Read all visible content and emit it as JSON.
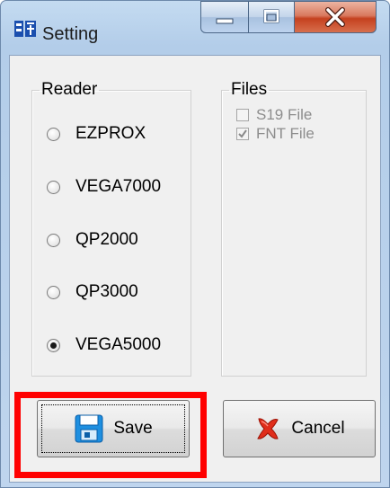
{
  "window": {
    "title": "Setting",
    "app_icon": "app-logo-icon",
    "controls": {
      "minimize": "minimize-icon",
      "maximize": "maximize-icon",
      "close": "close-icon"
    }
  },
  "reader_group": {
    "legend": "Reader",
    "options": [
      {
        "label": "EZPROX",
        "selected": false
      },
      {
        "label": "VEGA7000",
        "selected": false
      },
      {
        "label": "QP2000",
        "selected": false
      },
      {
        "label": "QP3000",
        "selected": false
      },
      {
        "label": "VEGA5000",
        "selected": true
      }
    ]
  },
  "files_group": {
    "legend": "Files",
    "items": [
      {
        "label": "S19 File",
        "checked": false,
        "enabled": false
      },
      {
        "label": "FNT File",
        "checked": true,
        "enabled": false
      }
    ]
  },
  "buttons": {
    "save_label": "Save",
    "save_icon": "floppy-disk-icon",
    "cancel_label": "Cancel",
    "cancel_icon": "red-x-icon"
  },
  "highlight_color": "#ff0000"
}
